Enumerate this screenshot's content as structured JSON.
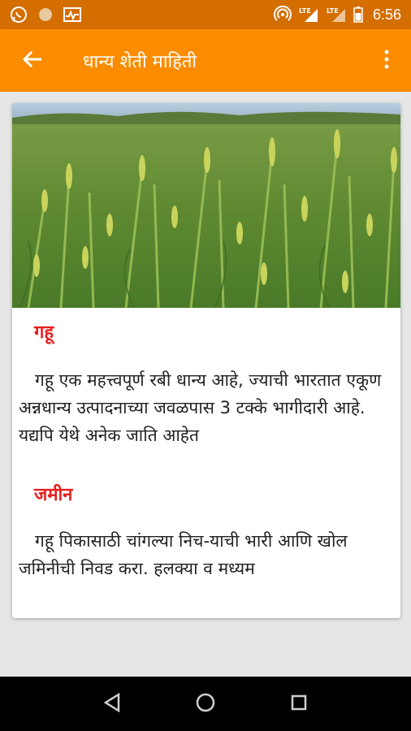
{
  "status_bar": {
    "left_icons": [
      "whatsapp-icon",
      "circle-notification-icon",
      "activity-chart-icon"
    ],
    "right_icons": [
      "hotspot-icon",
      "lte-signal-icon",
      "lte-signal-icon",
      "battery-icon"
    ],
    "lte_label_1": "LTE",
    "lte_label_2": "LTE",
    "time": "6:56"
  },
  "app_bar": {
    "title": "धान्य  शेती माहिती",
    "back_icon": "arrow-back-icon",
    "menu_icon": "more-vert-icon",
    "colors": {
      "primary": "#fb8c00",
      "status": "#d46e00"
    }
  },
  "card": {
    "image_alt": "wheat field",
    "sections": [
      {
        "heading": "गहू",
        "text": "गहू एक महत्त्वपूर्ण रबी धान्य आहे, ज्याची भारतात एकूण अन्नधान्य उत्पादनाच्या जवळपास 3 टक्के भागीदारी आहे. यद्यपि येथे अनेक जाति आहेत"
      },
      {
        "heading": "जमीन",
        "text": "गहू पिकासाठी चांगल्या निच-याची भारी आणि खोल जमिनीची निवड करा. हलक्या व मध्यम"
      }
    ],
    "heading_color": "#e81e1e"
  },
  "nav_bar": {
    "buttons": [
      "back-triangle-icon",
      "home-circle-icon",
      "recents-square-icon"
    ]
  }
}
